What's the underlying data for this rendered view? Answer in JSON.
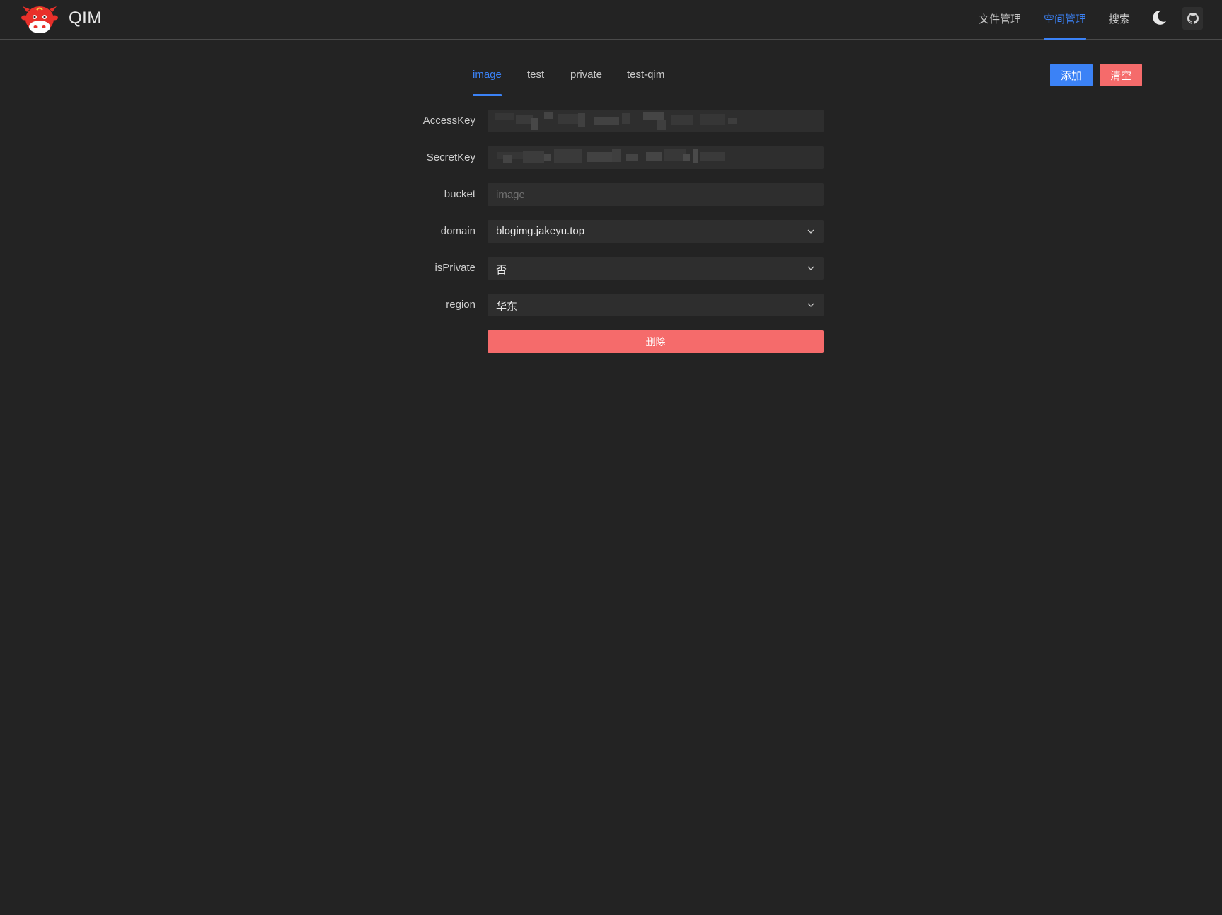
{
  "header": {
    "app_title": "QIM",
    "logo_icon": "cow-mascot-icon",
    "nav": [
      {
        "label": "文件管理",
        "active": false
      },
      {
        "label": "空间管理",
        "active": true
      },
      {
        "label": "搜索",
        "active": false
      }
    ],
    "theme_icon": "moon-icon",
    "github_icon": "github-icon"
  },
  "tabs": [
    {
      "label": "image",
      "active": true
    },
    {
      "label": "test",
      "active": false
    },
    {
      "label": "private",
      "active": false
    },
    {
      "label": "test-qim",
      "active": false
    }
  ],
  "actions": {
    "add_label": "添加",
    "clear_label": "清空"
  },
  "form": {
    "access_key": {
      "label": "AccessKey"
    },
    "secret_key": {
      "label": "SecretKey"
    },
    "bucket": {
      "label": "bucket",
      "value": "",
      "placeholder": "image"
    },
    "domain": {
      "label": "domain",
      "value": "blogimg.jakeyu.top"
    },
    "is_private": {
      "label": "isPrivate",
      "value": "否"
    },
    "region": {
      "label": "region",
      "value": "华东"
    },
    "delete_label": "删除"
  },
  "colors": {
    "background": "#232323",
    "accent": "#3b82f6",
    "danger": "#f56b6b",
    "field": "#2e2e2e"
  }
}
